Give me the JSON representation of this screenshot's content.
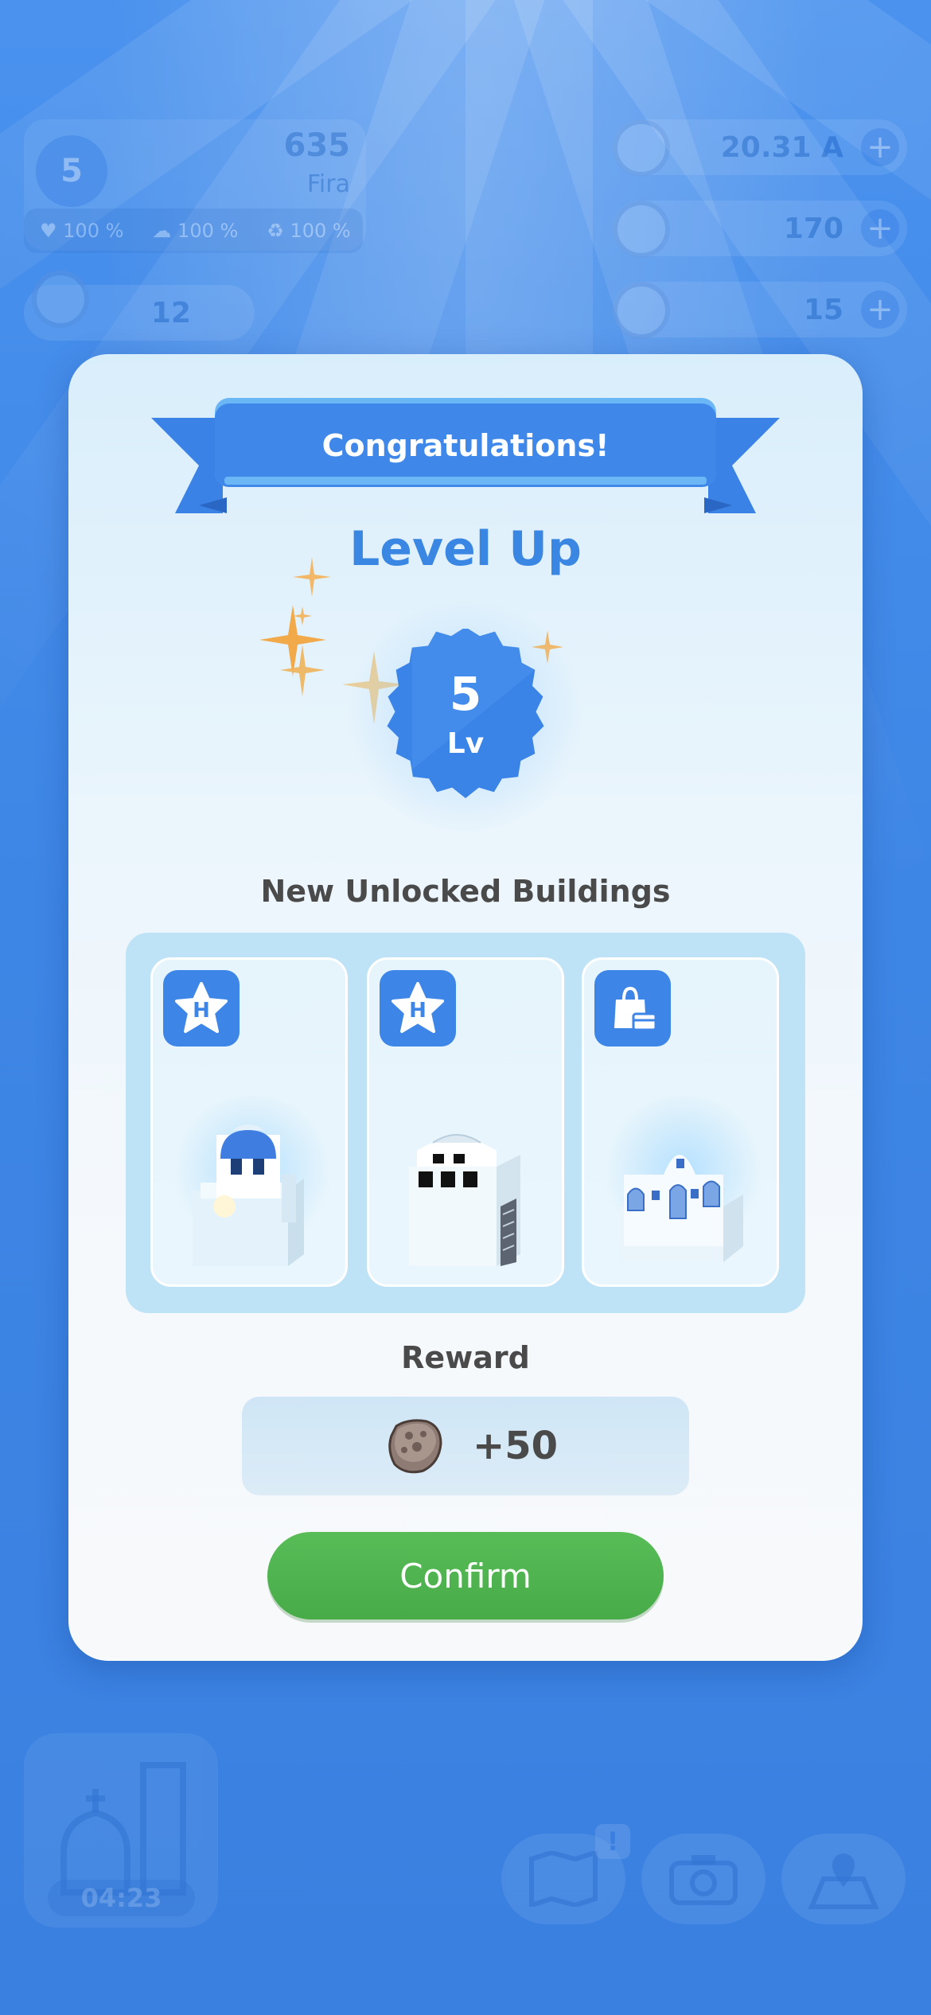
{
  "background_hud": {
    "player_level": "5",
    "score": "635",
    "city_name": "Fira",
    "stats": [
      {
        "icon": "heart-icon",
        "value": "100 %"
      },
      {
        "icon": "cloud-icon",
        "value": "100 %"
      },
      {
        "icon": "recycle-icon",
        "value": "100 %"
      }
    ],
    "population": "12",
    "currency": [
      {
        "icon": "energy-coin-icon",
        "value": "20.31 A"
      },
      {
        "icon": "stone-icon",
        "value": "170"
      },
      {
        "icon": "gem-icon",
        "value": "15"
      }
    ],
    "timer": "04:23",
    "notification_badge": "!"
  },
  "modal": {
    "banner_title": "Congratulations!",
    "heading": "Level Up",
    "level_number": "5",
    "level_suffix": "Lv",
    "unlocked_title": "New Unlocked Buildings",
    "buildings": [
      {
        "type_icon": "hotel-star-icon",
        "type_letter": "H",
        "name": "blue-dome-house"
      },
      {
        "type_icon": "hotel-star-icon",
        "type_letter": "H",
        "name": "white-tower-house"
      },
      {
        "type_icon": "shopping-bag-icon",
        "type_letter": "",
        "name": "white-villa"
      }
    ],
    "reward_title": "Reward",
    "reward_icon": "stone-icon",
    "reward_value": "+50",
    "confirm_label": "Confirm"
  },
  "colors": {
    "background": "#3f87e6",
    "accent_blue": "#3a86e3",
    "confirm_green": "#4fb54f",
    "text_dark": "#4a4a4a"
  }
}
